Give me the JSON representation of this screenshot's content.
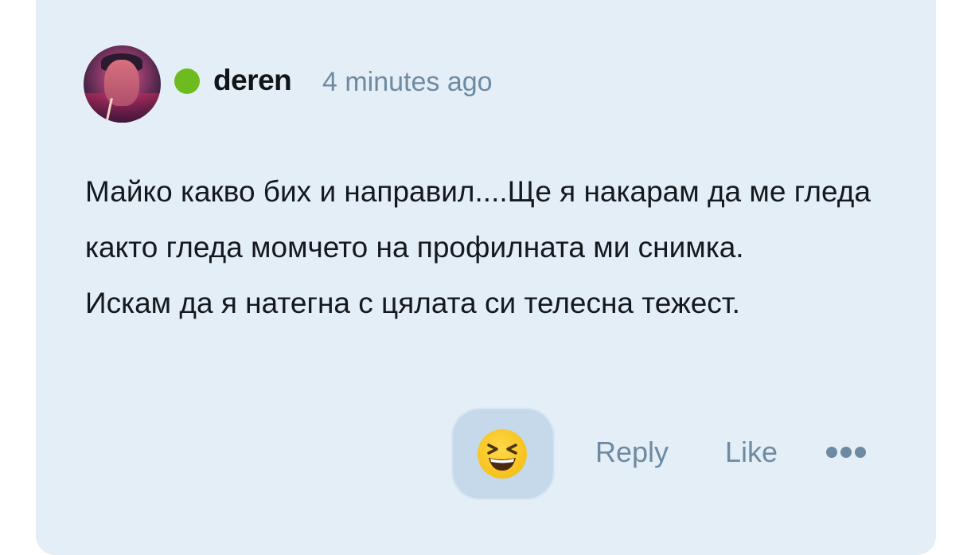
{
  "comment": {
    "author": "deren",
    "timestamp": "4 minutes ago",
    "online": true,
    "paragraphs": [
      "Майко какво бих и направил....Ще я накарам да ме гледа както гледа момчето на профилната ми снимка.",
      "Искам да я натегна с цялата си телесна тежест."
    ]
  },
  "actions": {
    "reaction_icon": "grinning-squinting-face-emoji",
    "reply_label": "Reply",
    "like_label": "Like",
    "more_icon": "more-horizontal-icon"
  },
  "colors": {
    "card_background": "#e4eef6",
    "online_status": "#6dbb1f",
    "muted_text": "#6e8aa2",
    "reaction_button": "#c5d9ea"
  }
}
